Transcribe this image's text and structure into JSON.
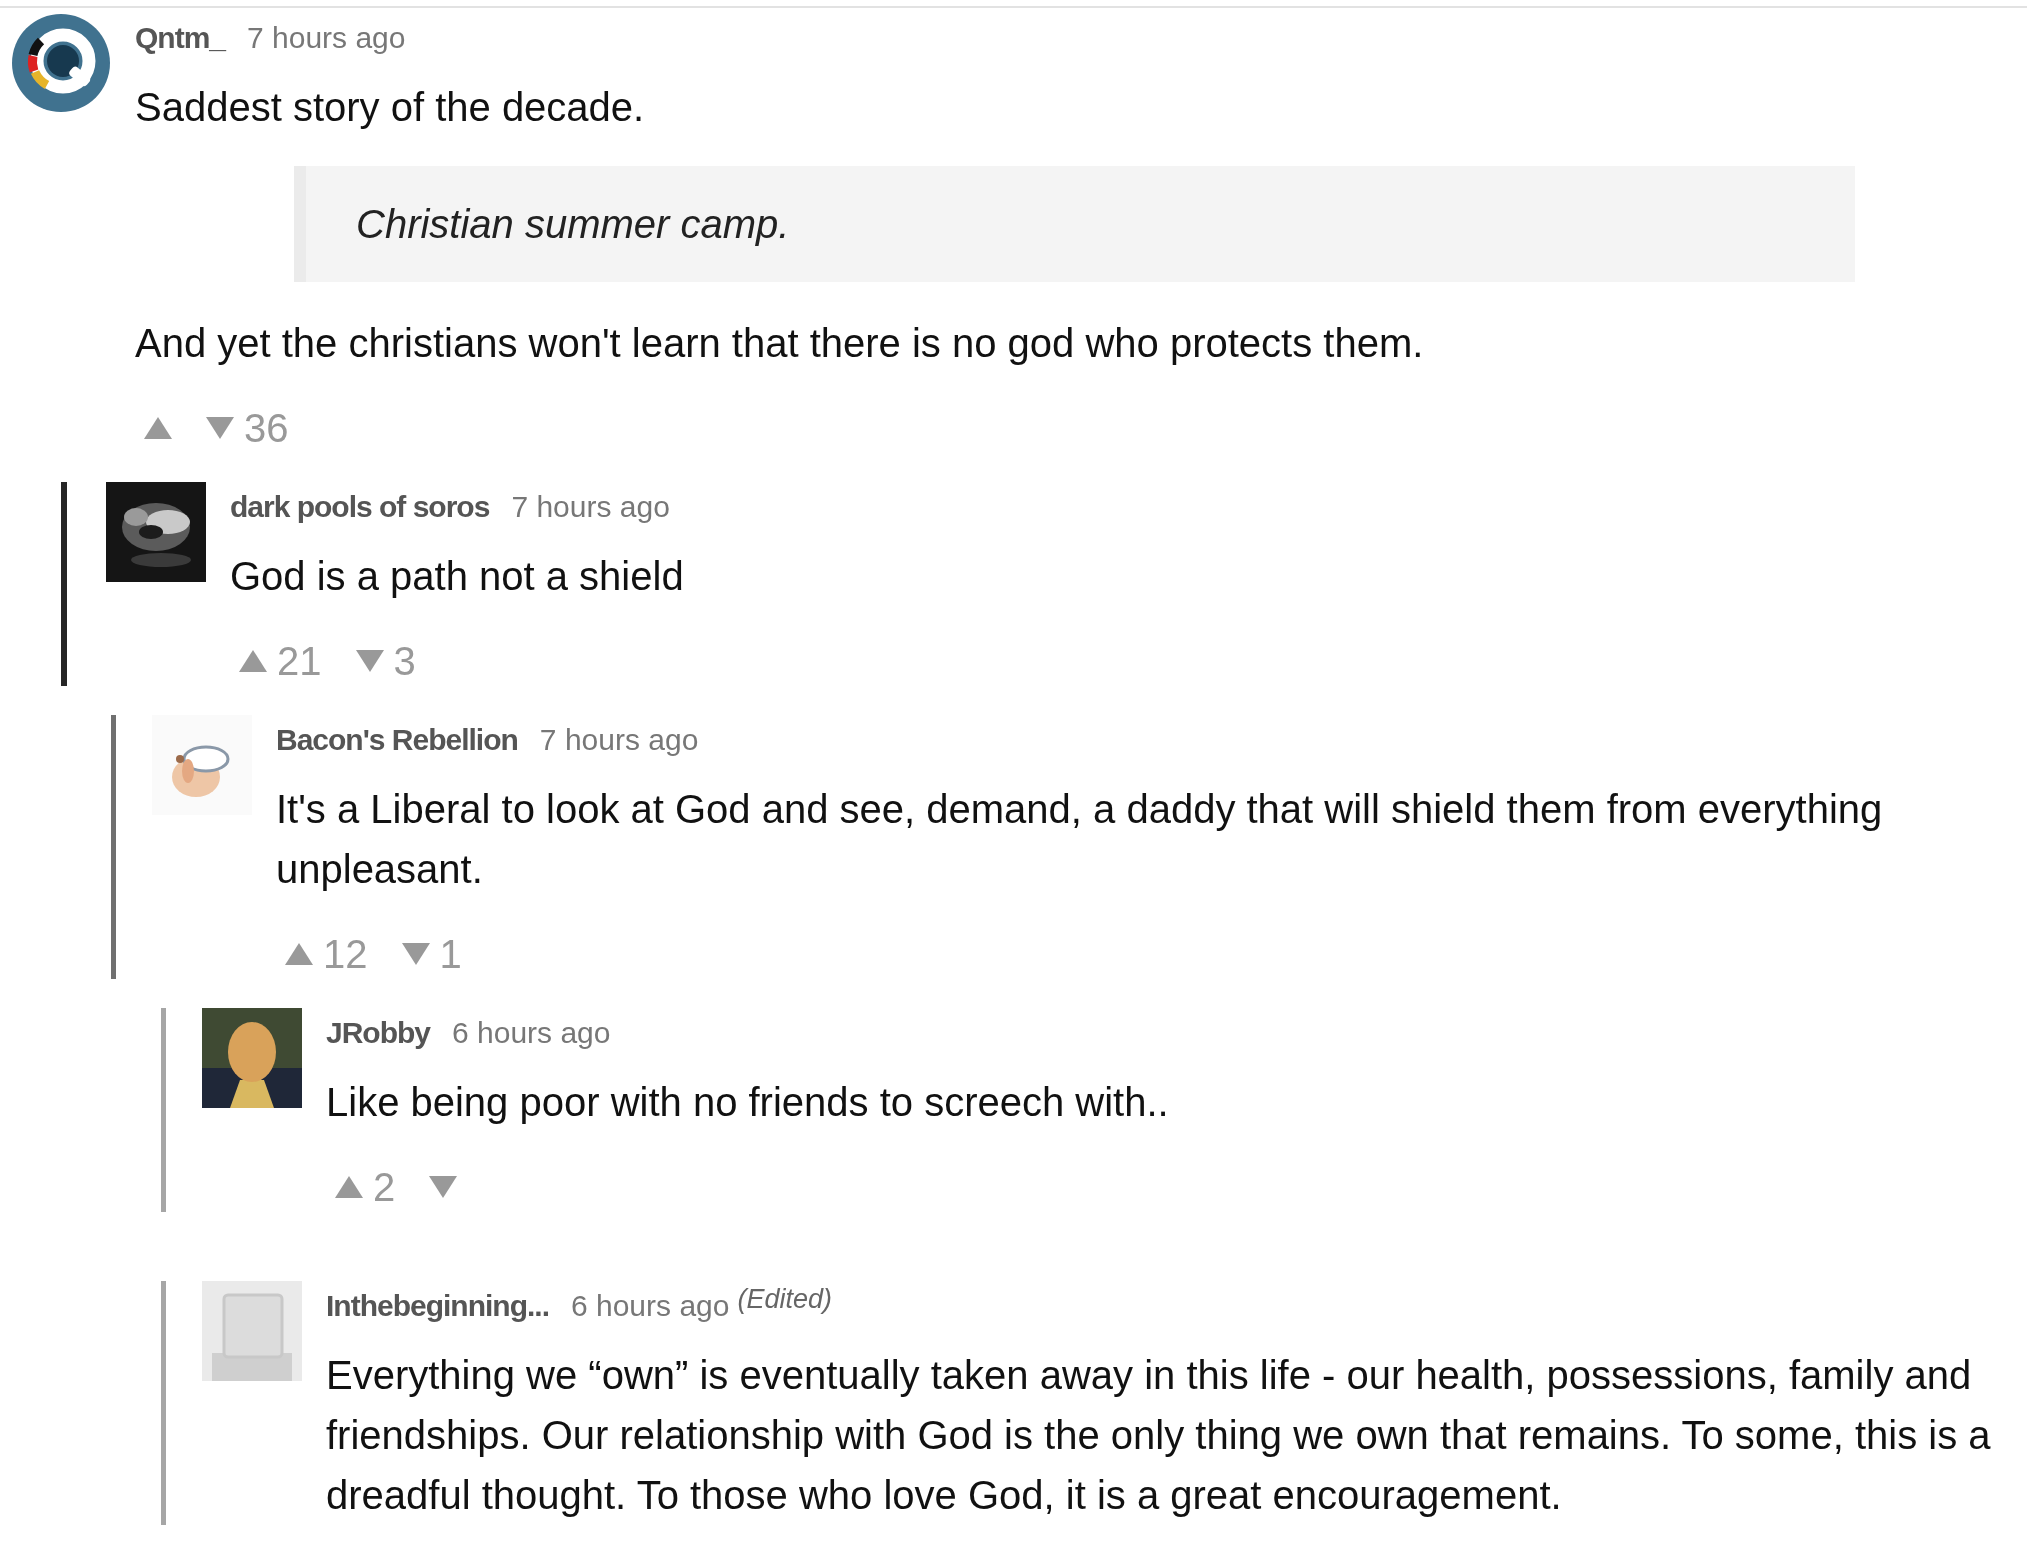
{
  "comments": [
    {
      "author": "Qntm_",
      "time": "7 hours ago",
      "avatar": {
        "kind": "picture"
      },
      "body": [
        {
          "kind": "text",
          "text": "Saddest story of the decade."
        },
        {
          "kind": "quote",
          "text": "Christian summer camp."
        },
        {
          "kind": "text",
          "text": "And yet the christians won't learn that there is no god who protects them."
        }
      ],
      "votes": {
        "down": "36"
      },
      "children": [
        {
          "author": "dark pools of soros",
          "time": "7 hours ago",
          "avatar": {
            "kind": "picture"
          },
          "body": [
            {
              "kind": "text",
              "text": "God is a path not a shield"
            }
          ],
          "votes": {
            "up": "21",
            "down": "3"
          },
          "children": [
            {
              "author": "Bacon's Rebellion",
              "time": "7 hours ago",
              "avatar": {
                "kind": "picture"
              },
              "body": [
                {
                  "kind": "text",
                  "text": "It's a Liberal to look at God and see, demand, a daddy that will shield them from everything unpleasant."
                }
              ],
              "votes": {
                "up": "12",
                "down": "1"
              },
              "children": [
                {
                  "author": "JRobby",
                  "time": "6 hours ago",
                  "avatar": {
                    "kind": "picture"
                  },
                  "body": [
                    {
                      "kind": "text",
                      "text": "Like being poor with no friends to screech with.."
                    }
                  ],
                  "votes": {
                    "up": "2"
                  }
                },
                {
                  "author": "Inthebeginning...",
                  "time": "6 hours ago",
                  "edited_label": "(Edited)",
                  "avatar": {
                    "kind": "picture"
                  },
                  "body": [
                    {
                      "kind": "text",
                      "text": "Everything we “own” is eventually taken away in this life - our health, possessions, family and friendships. Our relationship with God is the only thing we own that remains. To some, this is a dreadful thought. To those who love God, it is a great encouragement."
                    }
                  ]
                }
              ]
            }
          ]
        }
      ]
    }
  ]
}
